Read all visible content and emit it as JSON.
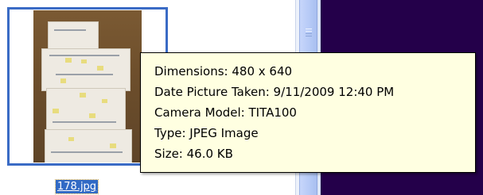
{
  "file": {
    "name": "178.jpg",
    "thumbnail_icon": "photo-thumbnail"
  },
  "tooltip": {
    "lines": [
      "Dimensions: 480 x 640",
      "Date Picture Taken: 9/11/2009 12:40 PM",
      "Camera Model: TITA100",
      "Type: JPEG Image",
      "Size: 46.0 KB"
    ]
  },
  "colors": {
    "selection": "#316ac5",
    "tooltip_bg": "#ffffe1",
    "right_pane_bg": "#24004a",
    "thumb_border": "#3a6bc5"
  }
}
